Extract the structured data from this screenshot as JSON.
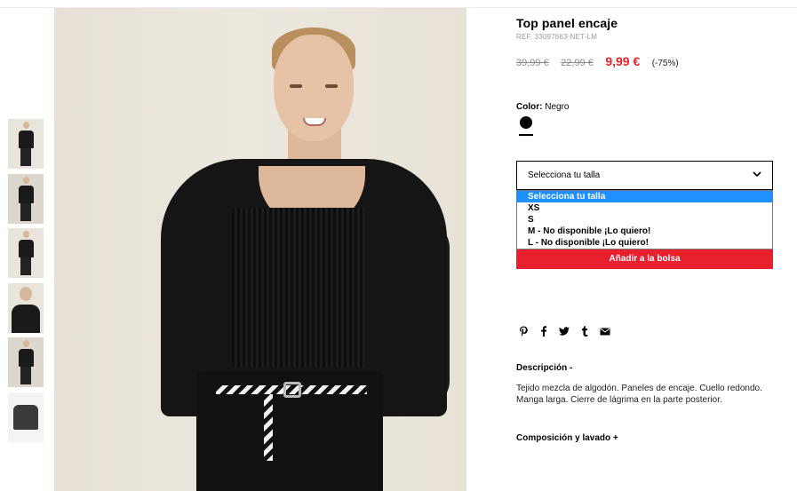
{
  "product": {
    "title": "Top panel encaje",
    "ref": "REF. 33097663-NET-LM",
    "price_original": "39,99 €",
    "price_previous": "22,99 €",
    "price_current": "9,99 €",
    "discount": "(-75%)"
  },
  "color": {
    "label": "Color:",
    "value": "Negro",
    "swatch_color": "#000000"
  },
  "size": {
    "selected": "Selecciona tu talla",
    "options": [
      "Selecciona tu talla",
      "XS",
      "S",
      "M - No disponible ¡Lo quiero!",
      "L - No disponible ¡Lo quiero!"
    ]
  },
  "add_to_bag": "Añadir a la bolsa",
  "share_icons": [
    "pinterest-icon",
    "facebook-icon",
    "twitter-icon",
    "tumblr-icon",
    "email-icon"
  ],
  "description": {
    "heading": "Descripción -",
    "text": "Tejido mezcla de algodón. Paneles de encaje. Cuello redondo. Manga larga. Cierre de lágrima en la parte posterior."
  },
  "composition": {
    "heading": "Composición y lavado +"
  },
  "colors": {
    "accent_red": "#e8202e",
    "selected_option_blue": "#1e90ff"
  }
}
